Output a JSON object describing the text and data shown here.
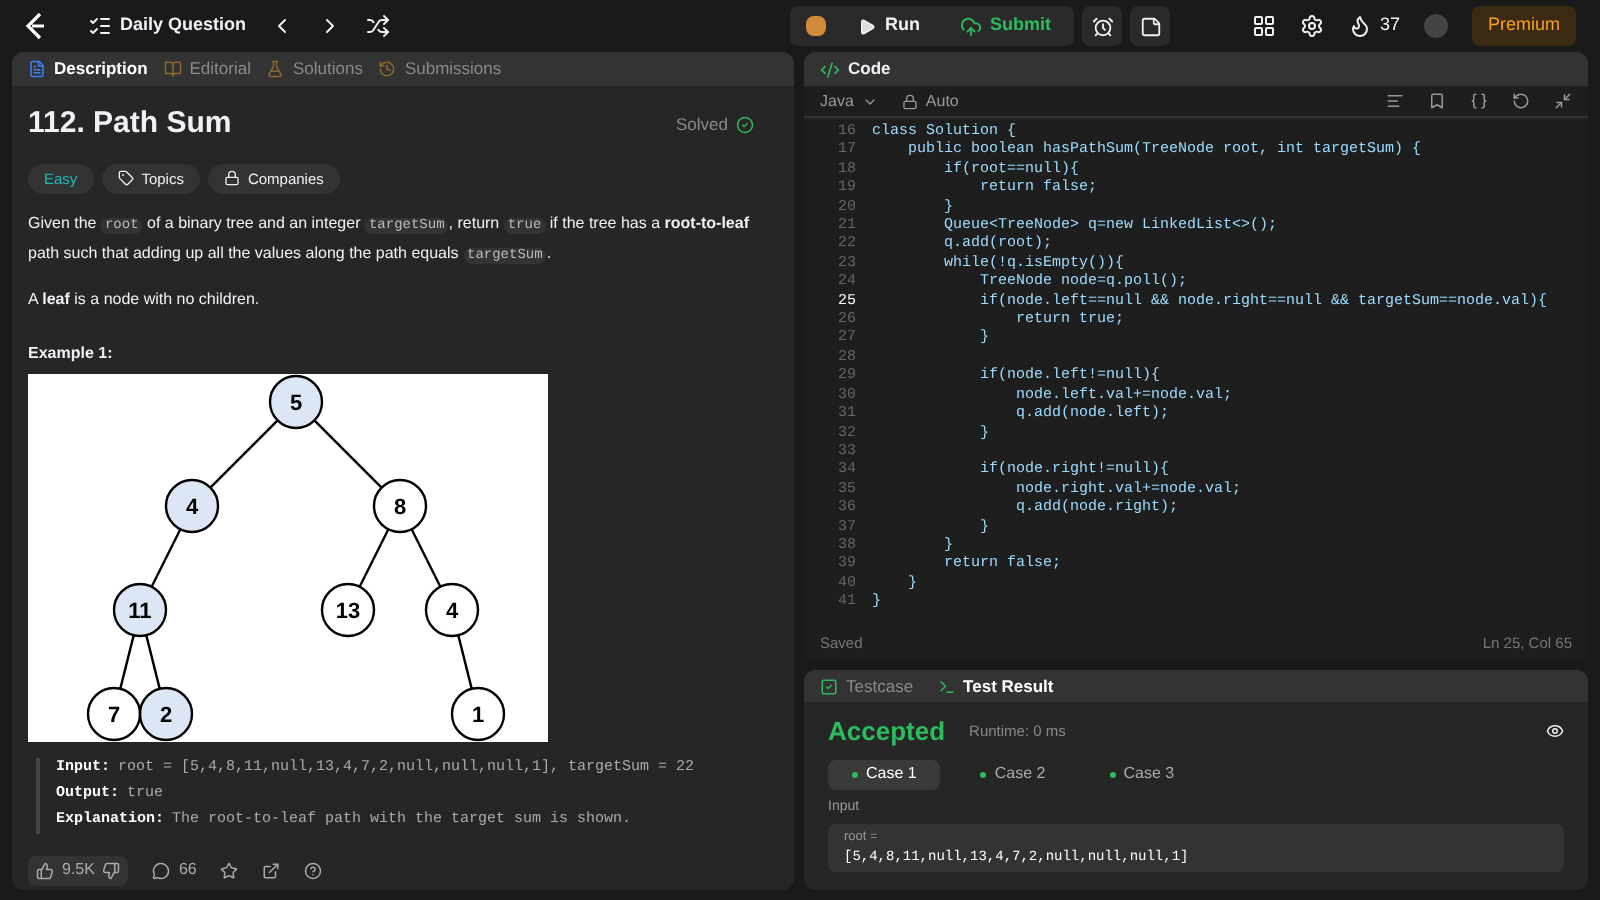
{
  "top_bar": {
    "title": "Daily Question",
    "run": "Run",
    "submit": "Submit",
    "streak": "37",
    "premium": "Premium"
  },
  "left_tabs": [
    {
      "label": "Description",
      "selected": true
    },
    {
      "label": "Editorial",
      "selected": false
    },
    {
      "label": "Solutions",
      "selected": false
    },
    {
      "label": "Submissions",
      "selected": false
    }
  ],
  "problem": {
    "title": "112. Path Sum",
    "status": "Solved",
    "difficulty": "Easy",
    "tags": [
      "Topics",
      "Companies"
    ],
    "paragraphs": [
      [
        {
          "kind": "text",
          "text": "Given the "
        },
        {
          "kind": "code",
          "text": "root"
        },
        {
          "kind": "text",
          "text": " of a binary tree and an integer "
        },
        {
          "kind": "code",
          "text": "targetSum"
        },
        {
          "kind": "text",
          "text": ", return "
        },
        {
          "kind": "code",
          "text": "true"
        },
        {
          "kind": "text",
          "text": " if the tree has a "
        },
        {
          "kind": "bold",
          "text": "root-to-leaf"
        },
        {
          "kind": "text",
          "text": " path such that adding up all the values along the path equals "
        },
        {
          "kind": "code",
          "text": "targetSum"
        },
        {
          "kind": "text",
          "text": "."
        }
      ],
      [
        {
          "kind": "text",
          "text": "A "
        },
        {
          "kind": "bold",
          "text": "leaf"
        },
        {
          "kind": "text",
          "text": " is a node with no children."
        }
      ]
    ],
    "example": {
      "heading": "Example 1:",
      "tree": {
        "label": "5",
        "highlighted": true,
        "children": [
          {
            "kind": "left",
            "label": "4",
            "highlighted": true,
            "children": [
              {
                "kind": "left",
                "label": "11",
                "highlighted": true,
                "children": [
                  {
                    "kind": "left",
                    "label": "7",
                    "highlighted": false
                  },
                  {
                    "kind": "right",
                    "label": "2",
                    "highlighted": true
                  }
                ]
              }
            ]
          },
          {
            "kind": "right",
            "label": "8",
            "highlighted": false,
            "children": [
              {
                "kind": "left",
                "label": "13",
                "highlighted": false
              },
              {
                "kind": "right",
                "label": "4",
                "highlighted": false,
                "children": [
                  {
                    "kind": "right",
                    "label": "1",
                    "highlighted": false
                  }
                ]
              }
            ]
          }
        ]
      },
      "lines": [
        {
          "label": "Input:",
          "value": "root = [5,4,8,11,null,13,4,7,2,null,null,null,1], targetSum = 22"
        },
        {
          "label": "Output:",
          "value": "true"
        },
        {
          "label": "Explanation:",
          "value": "The root-to-leaf path with the target sum is shown."
        }
      ]
    },
    "likes": "9.5K",
    "comments": "66"
  },
  "code": {
    "title": "Code",
    "language": "Java",
    "mode": "Auto",
    "lines": [
      {
        "number": "16",
        "text": "class Solution {",
        "current": false
      },
      {
        "number": "17",
        "text": "    public boolean hasPathSum(TreeNode root, int targetSum) {",
        "current": false
      },
      {
        "number": "18",
        "text": "        if(root==null){",
        "current": false
      },
      {
        "number": "19",
        "text": "            return false;",
        "current": false
      },
      {
        "number": "20",
        "text": "        }",
        "current": false
      },
      {
        "number": "21",
        "text": "        Queue<TreeNode> q=new LinkedList<>();",
        "current": false
      },
      {
        "number": "22",
        "text": "        q.add(root);",
        "current": false
      },
      {
        "number": "23",
        "text": "        while(!q.isEmpty()){",
        "current": false
      },
      {
        "number": "24",
        "text": "            TreeNode node=q.poll();",
        "current": false
      },
      {
        "number": "25",
        "text": "            if(node.left==null && node.right==null && targetSum==node.val){",
        "current": true
      },
      {
        "number": "26",
        "text": "                return true;",
        "current": false
      },
      {
        "number": "27",
        "text": "            }",
        "current": false
      },
      {
        "number": "28",
        "current": false
      },
      {
        "number": "29",
        "text": "            if(node.left!=null){",
        "current": false
      },
      {
        "number": "30",
        "text": "                node.left.val+=node.val;",
        "current": false
      },
      {
        "number": "31",
        "text": "                q.add(node.left);",
        "current": false
      },
      {
        "number": "32",
        "text": "            }",
        "current": false
      },
      {
        "number": "33",
        "current": false
      },
      {
        "number": "34",
        "text": "            if(node.right!=null){",
        "current": false
      },
      {
        "number": "35",
        "text": "                node.right.val+=node.val;",
        "current": false
      },
      {
        "number": "36",
        "text": "                q.add(node.right);",
        "current": false
      },
      {
        "number": "37",
        "text": "            }",
        "current": false
      },
      {
        "number": "38",
        "text": "        }",
        "current": false
      },
      {
        "number": "39",
        "text": "        return false;",
        "current": false
      },
      {
        "number": "40",
        "text": "    }",
        "current": false
      },
      {
        "number": "41",
        "text": "}",
        "current": false
      }
    ],
    "status": "Saved",
    "cursor": "Ln 25, Col 65"
  },
  "test": {
    "tabs": [
      {
        "label": "Testcase",
        "selected": false
      },
      {
        "label": "Test Result",
        "selected": true
      }
    ],
    "verdict": "Accepted",
    "runtime": "Runtime: 0 ms",
    "cases": [
      {
        "label": "Case 1",
        "selected": true
      },
      {
        "label": "Case 2",
        "selected": false
      },
      {
        "label": "Case 3",
        "selected": false
      }
    ],
    "input_label": "Input",
    "param": "root =",
    "value": "[5,4,8,11,null,13,4,7,2,null,null,null,1]"
  }
}
